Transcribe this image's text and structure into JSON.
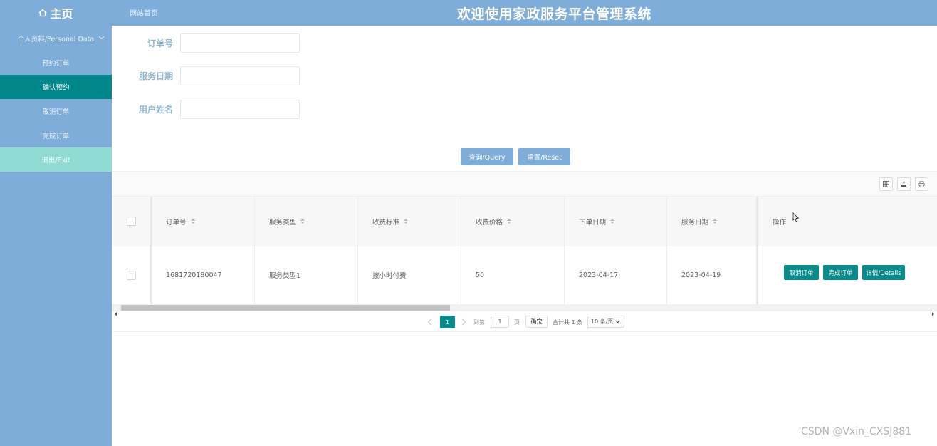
{
  "header": {
    "brand": "主页",
    "site_link": "网站首页",
    "title": "欢迎使用家政服务平台管理系统"
  },
  "sidebar": {
    "group_label": "个人资料/Personal Data",
    "items": [
      {
        "label": "预约订单"
      },
      {
        "label": "确认预约"
      },
      {
        "label": "取消订单"
      },
      {
        "label": "完成订单"
      },
      {
        "label": "退出/Exit"
      }
    ]
  },
  "search": {
    "order_label": "订单号",
    "date_label": "服务日期",
    "user_label": "用户姓名",
    "query_btn": "查询/Query",
    "reset_btn": "重置/Reset"
  },
  "table": {
    "columns": [
      "订单号",
      "服务类型",
      "收费标准",
      "收费价格",
      "下单日期",
      "服务日期",
      "操作"
    ],
    "rows": [
      [
        "1681720180047",
        "服务类型1",
        "按小时付费",
        "50",
        "2023-04-17",
        "2023-04-19"
      ]
    ],
    "actions": [
      "取消订单",
      "完成订单",
      "详情/Details"
    ]
  },
  "pagination": {
    "current_page": "1",
    "goto_label": "到第",
    "page_value": "1",
    "page_unit": "页",
    "confirm": "确定",
    "total": "合计共 1 条",
    "page_size": "10 条/页"
  },
  "watermark": "CSDN @Vxin_CXSJ881",
  "colors": {
    "accent": "#7eadd9",
    "active": "#00868b",
    "exit": "#90dcd4",
    "action": "#0a8a8a"
  }
}
